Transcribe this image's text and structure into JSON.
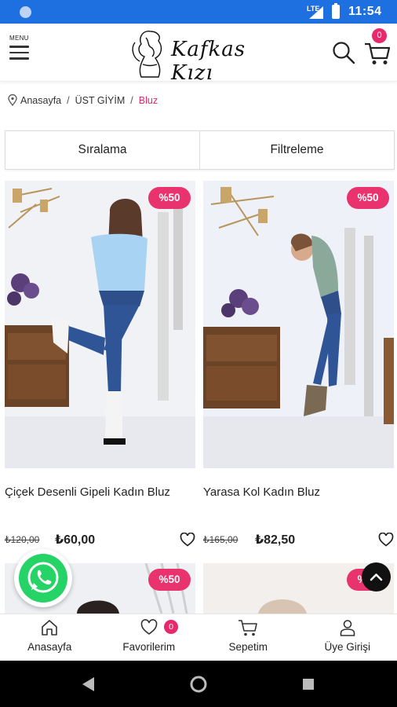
{
  "status_bar": {
    "time": "11:54",
    "network": "LTE"
  },
  "header": {
    "menu_label": "MENU",
    "logo_text": "Kafkas Kızı",
    "cart_count": "0"
  },
  "breadcrumb": {
    "home": "Anasayfa",
    "category": "ÜST GİYİM",
    "current": "Bluz"
  },
  "tools": {
    "sort_label": "Sıralama",
    "filter_label": "Filtreleme"
  },
  "products": [
    {
      "name": "Çiçek Desenli Gipeli Kadın Bluz",
      "discount": "%50",
      "old_price": "₺120,00",
      "price": "₺60,00"
    },
    {
      "name": "Yarasa Kol Kadın Bluz",
      "discount": "%50",
      "old_price": "₺165,00",
      "price": "₺82,50"
    }
  ],
  "next_row": [
    {
      "discount": "%50"
    },
    {
      "discount": "%50"
    }
  ],
  "bottom_nav": {
    "home": "Anasayfa",
    "favorites": "Favorilerim",
    "favorites_count": "0",
    "cart": "Sepetim",
    "login": "Üye Girişi"
  },
  "colors": {
    "accent": "#e6296a",
    "status_bar": "#1e6fe0",
    "whatsapp": "#25d366"
  }
}
